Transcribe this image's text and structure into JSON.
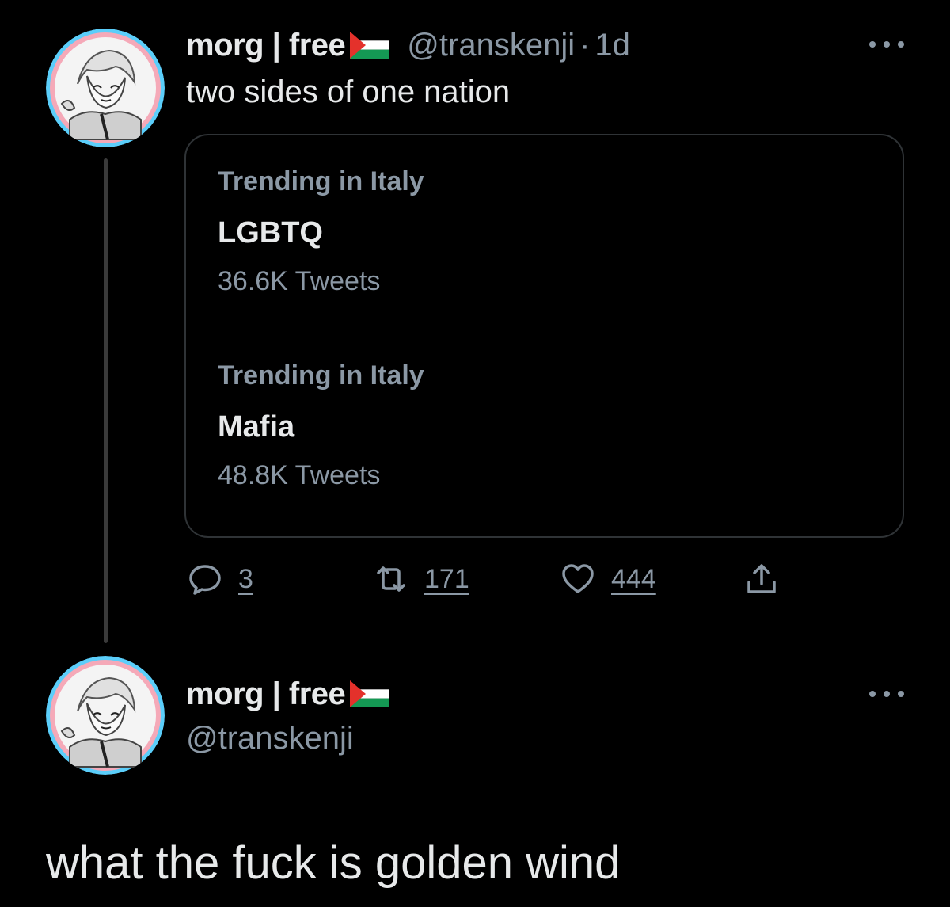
{
  "colors": {
    "background": "#000000",
    "primary_text": "#e7e9ea",
    "secondary_text": "#8b98a5",
    "border": "#2f3336",
    "trans_blue": "#5bcefa",
    "trans_pink": "#f5a9b8"
  },
  "tweet": {
    "display_name": "morg | free",
    "handle": "@transkenji",
    "separator": "·",
    "time": "1d",
    "text": "two sides of one nation",
    "more_icon": "more-horizontal-icon",
    "quote": {
      "trends": [
        {
          "context": "Trending in Italy",
          "name": "LGBTQ",
          "count": "36.6K Tweets"
        },
        {
          "context": "Trending in Italy",
          "name": "Mafia",
          "count": "48.8K Tweets"
        }
      ]
    },
    "actions": {
      "reply": {
        "icon": "reply-icon",
        "count": "3"
      },
      "retweet": {
        "icon": "retweet-icon",
        "count": "171"
      },
      "like": {
        "icon": "heart-icon",
        "count": "444"
      },
      "share": {
        "icon": "share-icon"
      }
    }
  },
  "reply": {
    "display_name": "morg | free",
    "handle": "@transkenji",
    "more_icon": "more-horizontal-icon",
    "text": "what the fuck is golden wind"
  }
}
